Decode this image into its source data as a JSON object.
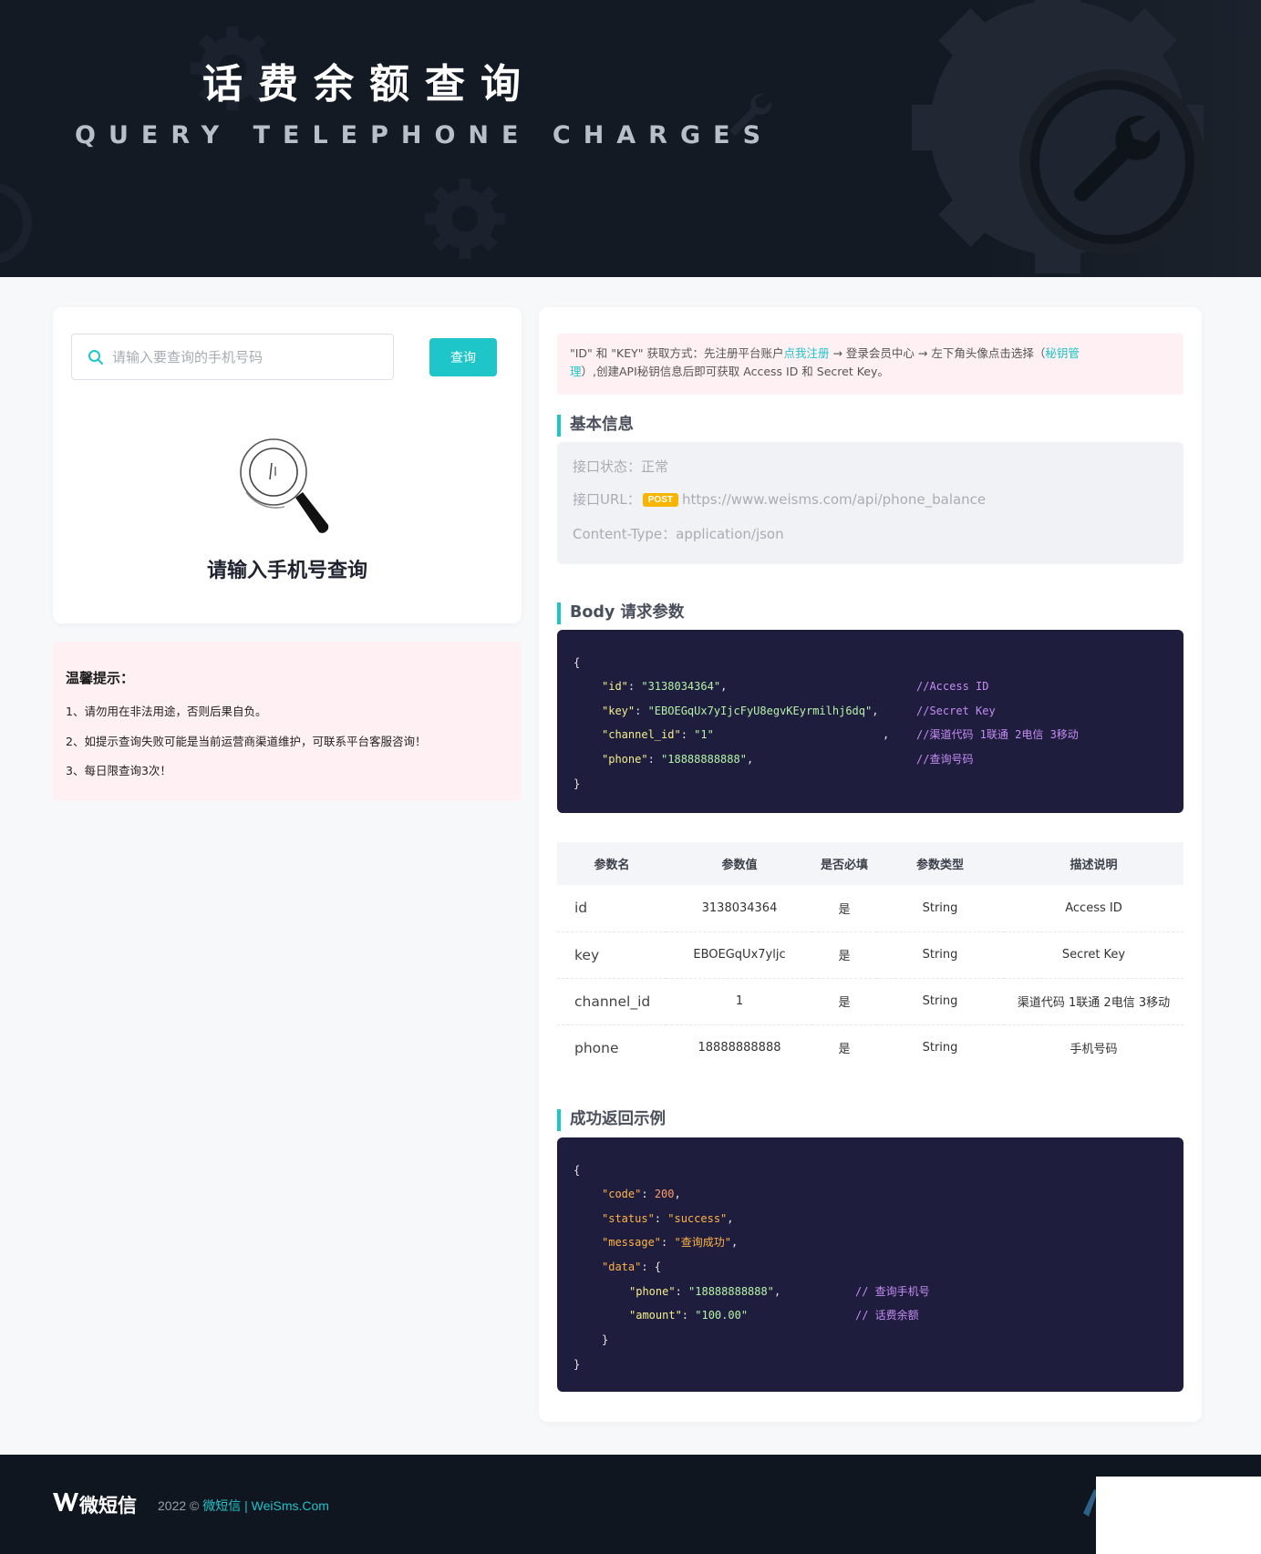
{
  "colors": {
    "accent": "#1ec5c9",
    "hero_bg": "#141a24",
    "footer_bg": "#0f1620",
    "code_bg": "#1f1d3d",
    "notice_bg": "#fef0f3",
    "post_badge": "#f7b500"
  },
  "hero": {
    "title": "话费余额查询",
    "subtitle": "QUERY TELEPHONE CHARGES",
    "icons": [
      "gear-icon",
      "wrench-icon"
    ]
  },
  "search": {
    "placeholder": "请输入要查询的手机号码",
    "value": "",
    "button_label": "查询",
    "icon": "search-icon",
    "empty_icon": "magnifier-icon",
    "empty_text": "请输入手机号查询"
  },
  "tips": {
    "title": "温馨提示：",
    "items": [
      "1、请勿用在非法用途，否则后果自负。",
      "2、如提示查询失败可能是当前运营商渠道维护，可联系平台客服咨询！",
      "3、每日限查询3次！"
    ]
  },
  "notice": {
    "part1": "\"ID\" 和 \"KEY\" 获取方式：先注册平台账户",
    "register_link": "点我注册",
    "part2": " → 登录会员中心 → 左下角头像点击选择（",
    "key_link_1": "秘钥管",
    "key_link_2": "理",
    "part3": "）,创建API秘钥信息后即可获取 Access ID 和 Secret Key。"
  },
  "basic_info": {
    "title": "基本信息",
    "status_label": "接口状态：",
    "status_value": "正常",
    "url_label": "接口URL：",
    "method": "POST",
    "url": "https://www.weisms.com/api/phone_balance",
    "content_type_label": "Content-Type：",
    "content_type": "application/json"
  },
  "body_params": {
    "title": "Body 请求参数",
    "open_brace": "{",
    "close_brace": "}",
    "lines": [
      {
        "key": "\"id\"",
        "value": "\"3138034364\"",
        "comment": "//Access ID"
      },
      {
        "key": "\"key\"",
        "value": "\"EBOEGqUx7yIjcFyU8egvKEyrmilhj6dq\"",
        "comment": "//Secret Key"
      },
      {
        "key": "\"channel_id\"",
        "value": "\"1\"",
        "comment": "//渠道代码 1联通 2电信 3移动"
      },
      {
        "key": "\"phone\"",
        "value": "\"18888888888\"",
        "comment": "//查询号码"
      }
    ]
  },
  "params_table": {
    "headers": [
      "参数名",
      "参数值",
      "是否必填",
      "参数类型",
      "描述说明"
    ],
    "rows": [
      [
        "id",
        "3138034364",
        "是",
        "String",
        "Access ID"
      ],
      [
        "key",
        "EBOEGqUx7yljc",
        "是",
        "String",
        "Secret Key"
      ],
      [
        "channel_id",
        "1",
        "是",
        "String",
        "渠道代码 1联通 2电信 3移动"
      ],
      [
        "phone",
        "18888888888",
        "是",
        "String",
        "手机号码"
      ]
    ]
  },
  "success_example": {
    "title": "成功返回示例",
    "open_brace": "{",
    "close_brace": "}",
    "inner_close": "}",
    "code_key": "\"code\"",
    "code_value": "200",
    "status_key": "\"status\"",
    "status_value": "\"success\"",
    "message_key": "\"message\"",
    "message_value": "\"查询成功\"",
    "data_key": "\"data\"",
    "phone_key": "\"phone\"",
    "phone_value": "\"18888888888\"",
    "phone_comment": "// 查询手机号",
    "amount_key": "\"amount\"",
    "amount_value": "\"100.00\"",
    "amount_comment": "// 话费余额"
  },
  "footer": {
    "brand": "微短信",
    "copyright": "2022 © ",
    "site_link": "微短信 | WeiSms.Com",
    "logo_icon": "w-logo-icon"
  }
}
